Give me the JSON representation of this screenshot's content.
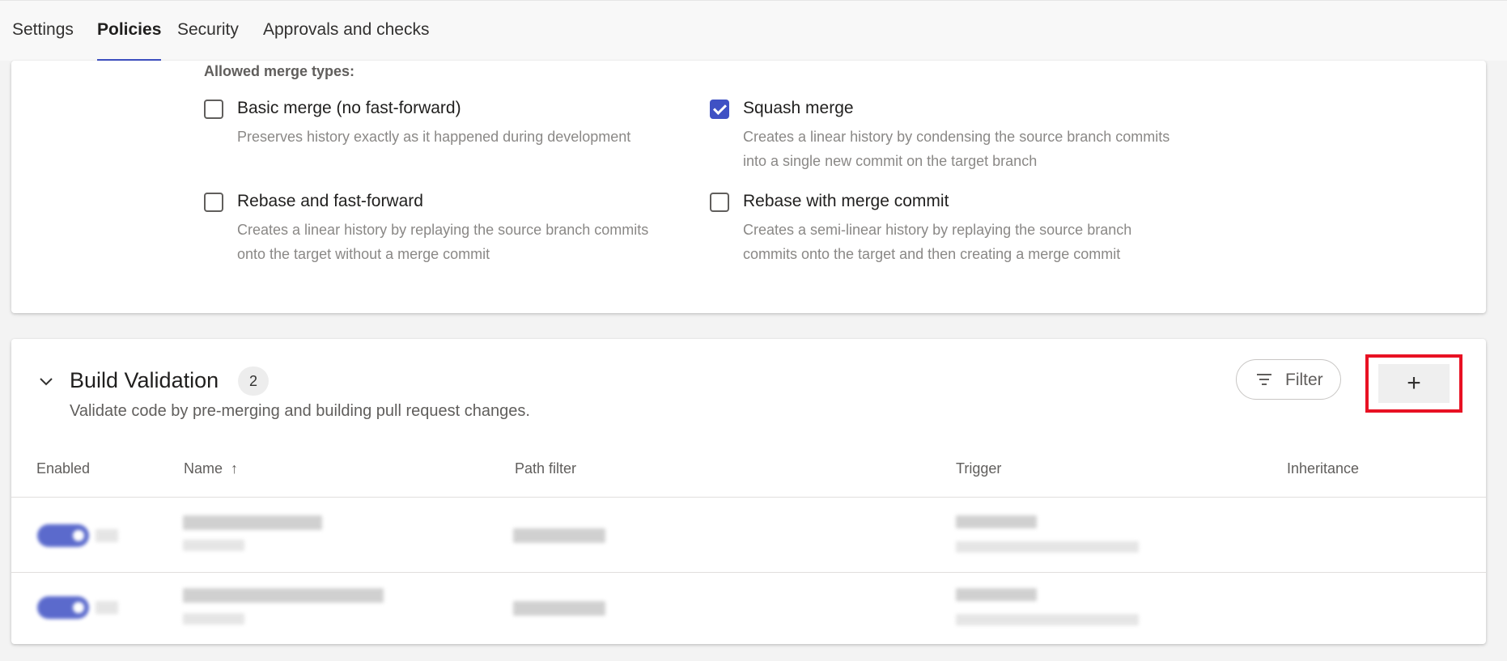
{
  "tabs": [
    {
      "label": "Settings",
      "active": false
    },
    {
      "label": "Policies",
      "active": true
    },
    {
      "label": "Security",
      "active": false
    },
    {
      "label": "Approvals and checks",
      "active": false
    }
  ],
  "merge_types": {
    "label": "Allowed merge types:",
    "options": [
      {
        "title": "Basic merge (no fast-forward)",
        "description": "Preserves history exactly as it happened during development",
        "checked": false
      },
      {
        "title": "Squash merge",
        "description": "Creates a linear history by condensing the source branch commits into a single new commit on the target branch",
        "checked": true
      },
      {
        "title": "Rebase and fast-forward",
        "description": "Creates a linear history by replaying the source branch commits onto the target without a merge commit",
        "checked": false
      },
      {
        "title": "Rebase with merge commit",
        "description": "Creates a semi-linear history by replaying the source branch commits onto the target and then creating a merge commit",
        "checked": false
      }
    ]
  },
  "build_validation": {
    "title": "Build Validation",
    "count": "2",
    "description": "Validate code by pre-merging and building pull request changes.",
    "filter_label": "Filter",
    "add_label": "+",
    "columns": {
      "enabled": "Enabled",
      "name": "Name",
      "name_sort_icon": "↑",
      "path_filter": "Path filter",
      "trigger": "Trigger",
      "inheritance": "Inheritance"
    },
    "row_count": 2
  },
  "colors": {
    "accent": "#3f51c4",
    "highlight_border": "#e81123"
  }
}
